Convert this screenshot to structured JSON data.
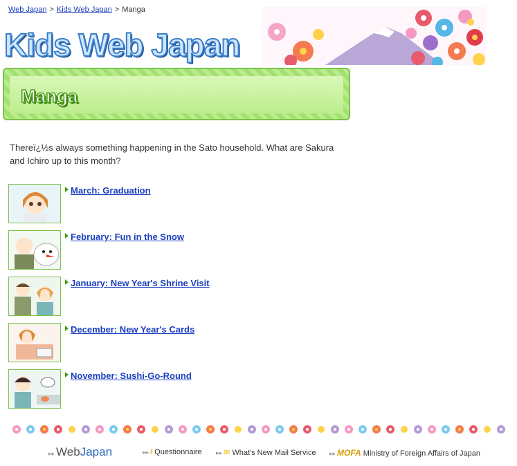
{
  "breadcrumb": {
    "items": [
      "Web Japan",
      "Kids Web Japan"
    ],
    "current": "Manga",
    "separator": ">"
  },
  "banner": {
    "logo_text": "Kids Web Japan"
  },
  "section": {
    "title": "Manga"
  },
  "intro": "Thereï¿½s always something happening in the Sato household. What are Sakura and Ichiro up to this month?",
  "manga": [
    {
      "label": "March: Graduation",
      "thumb_icon": "graduation-girl-icon"
    },
    {
      "label": "February: Fun in the Snow",
      "thumb_icon": "snowman-icon"
    },
    {
      "label": "January: New Year's Shrine Visit",
      "thumb_icon": "shrine-visit-icon"
    },
    {
      "label": "December: New Year's Cards",
      "thumb_icon": "new-years-cards-icon"
    },
    {
      "label": "November: Sushi-Go-Round",
      "thumb_icon": "sushi-icon"
    }
  ],
  "footer": {
    "web": "Web",
    "japan": "Japan",
    "questionnaire": "Questionnaire",
    "mail_service": "What's New Mail Service",
    "mofa": "MOFA",
    "ministry": "Ministry of Foreign Affairs of Japan"
  },
  "colors": {
    "link": "#1a3fbf",
    "header_green": "#7bc24a",
    "logo_blue": "#3a7fc9"
  }
}
